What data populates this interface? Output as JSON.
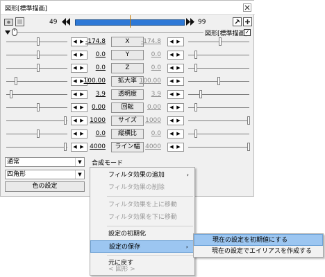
{
  "window": {
    "title": "図形[標準描画]",
    "close_glyph": "✕",
    "frame_start": "49",
    "frame_end": "99",
    "object_label": "図形[標準描画]",
    "object_checked": "✓"
  },
  "tracks": [
    {
      "name": "X",
      "left": "-174.8",
      "right": "-174.8"
    },
    {
      "name": "Y",
      "left": "0.0",
      "right": "0.0"
    },
    {
      "name": "Z",
      "left": "0.0",
      "right": "0.0"
    },
    {
      "name": "拡大率",
      "left": "100.00",
      "right": "100.00"
    },
    {
      "name": "透明度",
      "left": "3.9",
      "right": "3.9"
    },
    {
      "name": "回転",
      "left": "0.00",
      "right": "0.00"
    },
    {
      "name": "サイズ",
      "left": "1000",
      "right": "1000"
    },
    {
      "name": "縦横比",
      "left": "0.0",
      "right": "0.0"
    },
    {
      "name": "ライン幅",
      "left": "4000",
      "right": "4000"
    }
  ],
  "blend": {
    "value": "通常",
    "label": "合成モード"
  },
  "shape": {
    "value": "四角形"
  },
  "color_button": "色の設定",
  "context_menu": {
    "items": [
      {
        "label": "フィルタ効果の追加",
        "state": "enabled",
        "submenu": "›"
      },
      {
        "label": "フィルタ効果の削除",
        "state": "disabled"
      },
      {
        "label": "フィルタ効果を上に移動",
        "state": "disabled"
      },
      {
        "label": "フィルタ効果を下に移動",
        "state": "disabled"
      },
      {
        "label": "設定の初期化",
        "state": "enabled"
      },
      {
        "label": "設定の保存",
        "state": "highlighted",
        "submenu": "›"
      },
      {
        "label": "元に戻す",
        "state": "enabled"
      },
      {
        "label": "< 図形 >",
        "state": "disabled"
      }
    ]
  },
  "submenu": {
    "items": [
      {
        "label": "現在の設定を初期値にする",
        "state": "highlighted"
      },
      {
        "label": "現在の設定でエイリアスを作成する",
        "state": "enabled"
      }
    ]
  },
  "colors": {
    "timeline": "#2d78d6",
    "highlight": "#9cc6f1",
    "window_bg": "#f0f0f0"
  },
  "icons": [
    "prev-key-icon",
    "next-key-icon",
    "close-icon",
    "expand-triangle-icon",
    "mouse-icon",
    "camera-icon",
    "pin-icon",
    "dropdown-arrow-icon"
  ]
}
